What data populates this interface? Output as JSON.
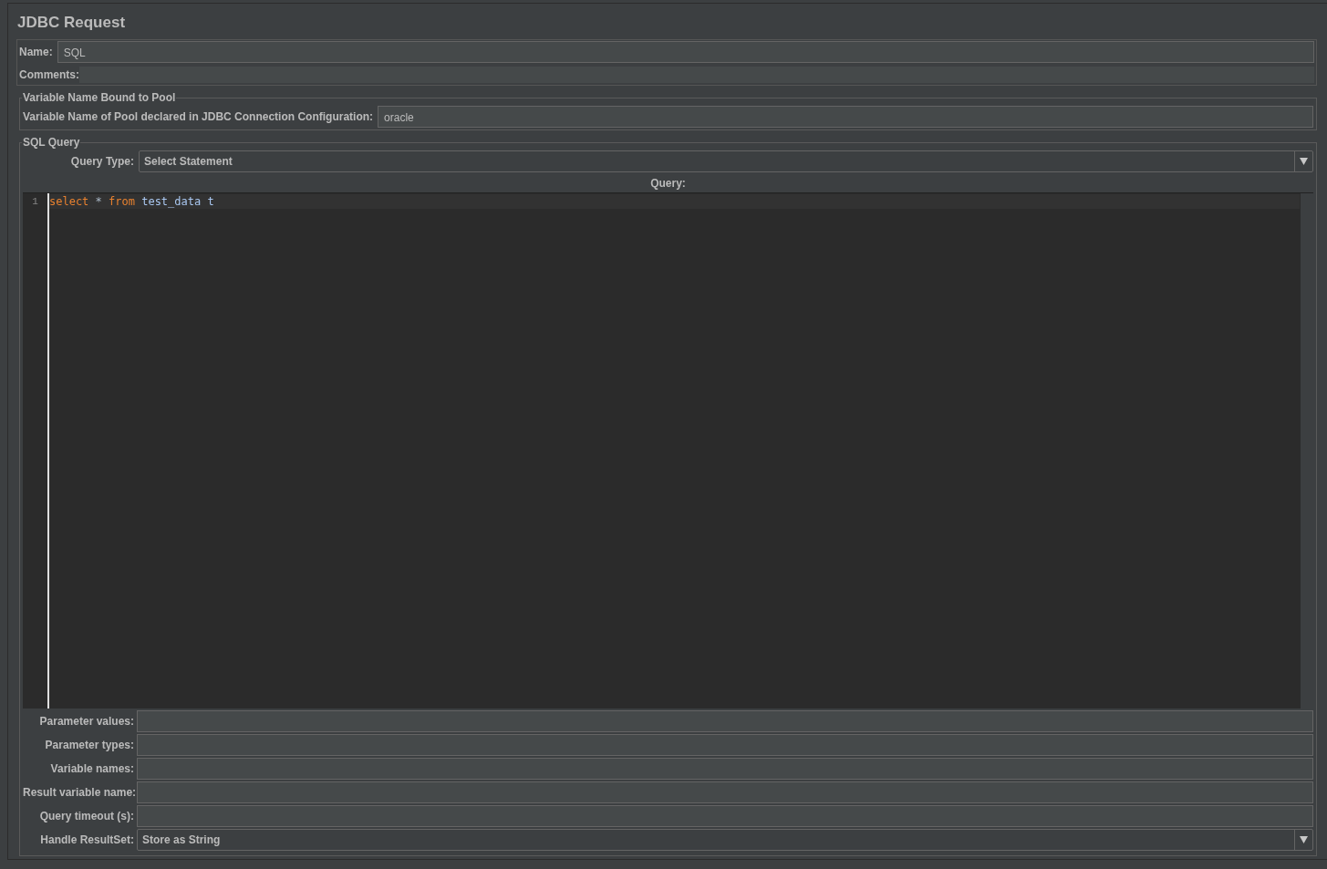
{
  "title": "JDBC Request",
  "name_field": {
    "label": "Name:",
    "value": "SQL"
  },
  "comments": {
    "label": "Comments:"
  },
  "pool": {
    "legend": "Variable Name Bound to Pool",
    "label": "Variable Name of Pool declared in JDBC Connection Configuration:",
    "value": "oracle"
  },
  "sql_query": {
    "legend": "SQL Query",
    "query_type": {
      "label": "Query Type:",
      "value": "Select Statement"
    },
    "editor": {
      "label": "Query:",
      "lines": [
        {
          "number": "1",
          "tokens": [
            {
              "text": "select",
              "kind": "keyword"
            },
            {
              "text": " * ",
              "kind": "operator"
            },
            {
              "text": "from",
              "kind": "keyword"
            },
            {
              "text": " test_data t",
              "kind": "identifier"
            }
          ]
        }
      ]
    },
    "params": [
      {
        "label": "Parameter values:",
        "kind": "text"
      },
      {
        "label": "Parameter types:",
        "kind": "text"
      },
      {
        "label": "Variable names:",
        "kind": "text"
      },
      {
        "label": "Result variable name:",
        "kind": "text"
      },
      {
        "label": "Query timeout (s):",
        "kind": "text"
      },
      {
        "label": "Handle ResultSet:",
        "kind": "select",
        "value": "Store as String"
      }
    ]
  }
}
